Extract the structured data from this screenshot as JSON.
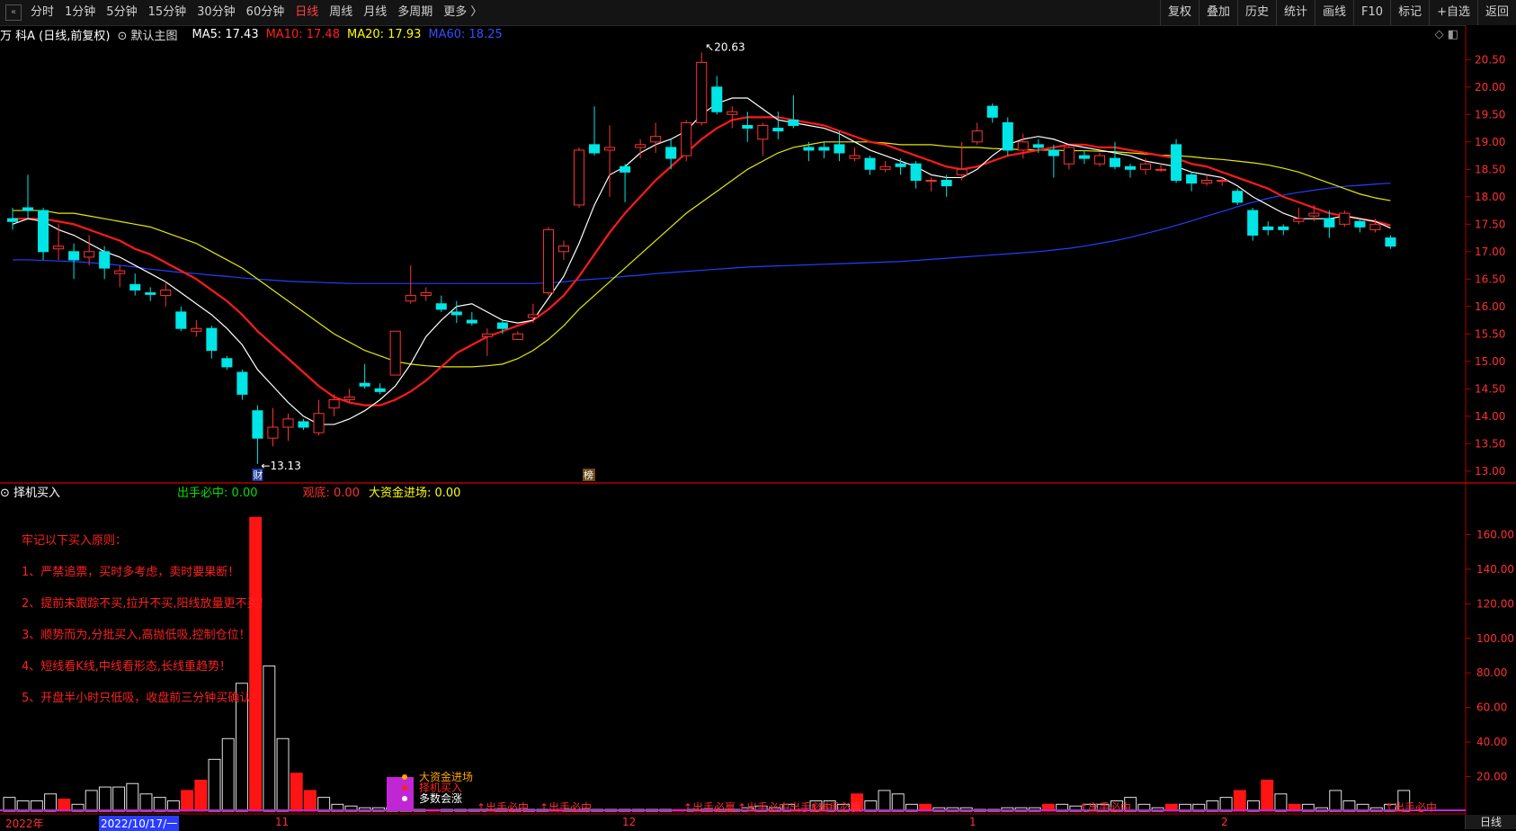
{
  "toolbar": {
    "collapse": "«",
    "periods": [
      "分时",
      "1分钟",
      "5分钟",
      "15分钟",
      "30分钟",
      "60分钟",
      "日线",
      "周线",
      "月线",
      "多周期",
      "更多 〉"
    ],
    "active_period": "日线",
    "right_buttons": [
      "复权",
      "叠加",
      "历史",
      "统计",
      "画线",
      "F10",
      "标记",
      "+自选",
      "返回"
    ]
  },
  "info": {
    "stock": "万 科A (日线,前复权)",
    "main_chart": "默认主图",
    "ma5": "MA5: 17.43",
    "ma10": "MA10: 17.48",
    "ma20": "MA20: 17.93",
    "ma60": "MA60: 18.25",
    "corner": "◇ ◧"
  },
  "panel": {
    "name": "择机买入",
    "f1": "出手必中: 0.00",
    "f2": "观底: 0.00",
    "f3": "大资金进场: 0.00"
  },
  "rules": [
    "牢记以下买入原则：",
    "1、严禁追票，买时多考虑，卖时要果断！",
    "2、提前未跟踪不买,拉升不买,阳线放量更不买！",
    "3、顺势而为,分批买入,高抛低吸,控制仓位！",
    "4、短线看K线,中线看形态,长线重趋势！",
    "5、开盘半小时只低吸，收盘前三分钟买确认！"
  ],
  "markers": {
    "low": "13.13",
    "high": "20.63",
    "cai": "财",
    "bang": "榜"
  },
  "legend": [
    "大资金进场",
    "择机买入",
    "多数会涨"
  ],
  "bottom_signals": [
    "出手必中",
    "出手必中",
    "出手必赢",
    "出手必中出手必中",
    "出手必赢",
    "出手必中",
    "出手必中"
  ],
  "date_axis": [
    "2022年",
    "2022/10/17/一",
    "11",
    "12",
    "1",
    "2"
  ],
  "period_label": "日线",
  "colors": {
    "up": "#ff3232",
    "down": "#00e5e5",
    "ma5": "#ffffff",
    "ma10": "#ff1a1a",
    "ma20": "#e8e800",
    "ma60": "#2040ff"
  },
  "chart_data": {
    "type": "candlestick",
    "ylim": [
      12.8,
      20.8
    ],
    "y_ticks": [
      "20.50",
      "20.00",
      "19.50",
      "19.00",
      "18.50",
      "18.00",
      "17.50",
      "17.00",
      "16.50",
      "16.00",
      "15.50",
      "15.00",
      "14.50",
      "14.00",
      "13.50",
      "13.00"
    ],
    "candles": [
      [
        17.6,
        17.55,
        17.8,
        17.4
      ],
      [
        17.8,
        17.75,
        18.4,
        17.6
      ],
      [
        17.75,
        17.0,
        17.8,
        16.85
      ],
      [
        17.05,
        17.1,
        17.5,
        16.85
      ],
      [
        17.0,
        16.85,
        17.15,
        16.5
      ],
      [
        16.9,
        17.0,
        17.3,
        16.75
      ],
      [
        17.0,
        16.7,
        17.1,
        16.5
      ],
      [
        16.6,
        16.65,
        16.75,
        16.35
      ],
      [
        16.4,
        16.3,
        16.6,
        16.2
      ],
      [
        16.25,
        16.22,
        16.35,
        16.1
      ],
      [
        16.2,
        16.3,
        16.45,
        16.0
      ],
      [
        15.9,
        15.6,
        16.0,
        15.55
      ],
      [
        15.55,
        15.6,
        15.75,
        15.45
      ],
      [
        15.6,
        15.2,
        15.65,
        15.05
      ],
      [
        15.05,
        14.9,
        15.1,
        14.85
      ],
      [
        14.8,
        14.4,
        14.85,
        14.3
      ],
      [
        14.1,
        13.6,
        14.2,
        13.13
      ],
      [
        13.6,
        13.8,
        14.15,
        13.45
      ],
      [
        13.8,
        13.95,
        14.05,
        13.55
      ],
      [
        13.9,
        13.8,
        13.95,
        13.75
      ],
      [
        13.7,
        14.05,
        14.3,
        13.65
      ],
      [
        14.15,
        14.3,
        14.4,
        14.0
      ],
      [
        14.3,
        14.35,
        14.5,
        14.25
      ],
      [
        14.6,
        14.55,
        14.95,
        14.5
      ],
      [
        14.5,
        14.45,
        14.6,
        14.4
      ],
      [
        14.75,
        15.55,
        15.55,
        14.75
      ],
      [
        16.1,
        16.2,
        16.75,
        16.05
      ],
      [
        16.2,
        16.25,
        16.35,
        16.1
      ],
      [
        16.05,
        15.95,
        16.2,
        15.9
      ],
      [
        15.9,
        15.85,
        16.1,
        15.7
      ],
      [
        15.75,
        15.7,
        15.9,
        15.65
      ],
      [
        15.45,
        15.5,
        15.6,
        15.1
      ],
      [
        15.7,
        15.6,
        15.75,
        15.5
      ],
      [
        15.4,
        15.5,
        15.55,
        15.4
      ],
      [
        15.8,
        15.85,
        16.05,
        15.7
      ],
      [
        16.25,
        17.4,
        17.45,
        16.2
      ],
      [
        17.0,
        17.1,
        17.2,
        16.85
      ],
      [
        17.85,
        18.85,
        18.9,
        17.8
      ],
      [
        18.95,
        18.8,
        19.65,
        18.75
      ],
      [
        18.85,
        18.9,
        19.3,
        18.0
      ],
      [
        18.55,
        18.45,
        18.6,
        17.9
      ],
      [
        18.9,
        18.95,
        19.05,
        18.7
      ],
      [
        19.0,
        19.1,
        19.35,
        18.8
      ],
      [
        18.9,
        18.7,
        19.05,
        18.5
      ],
      [
        18.75,
        19.35,
        19.4,
        18.65
      ],
      [
        19.35,
        20.45,
        20.63,
        19.3
      ],
      [
        20.0,
        19.55,
        20.2,
        19.5
      ],
      [
        19.5,
        19.55,
        19.65,
        19.25
      ],
      [
        19.3,
        19.25,
        19.55,
        19.0
      ],
      [
        19.05,
        19.3,
        19.35,
        18.75
      ],
      [
        19.25,
        19.2,
        19.55,
        19.05
      ],
      [
        19.4,
        19.3,
        19.85,
        19.25
      ],
      [
        18.9,
        18.85,
        19.0,
        18.65
      ],
      [
        18.9,
        18.85,
        19.0,
        18.7
      ],
      [
        18.95,
        18.8,
        19.2,
        18.65
      ],
      [
        18.7,
        18.75,
        18.9,
        18.65
      ],
      [
        18.7,
        18.5,
        18.75,
        18.4
      ],
      [
        18.5,
        18.55,
        18.65,
        18.45
      ],
      [
        18.6,
        18.55,
        18.7,
        18.4
      ],
      [
        18.6,
        18.3,
        18.65,
        18.15
      ],
      [
        18.3,
        18.3,
        18.35,
        18.1
      ],
      [
        18.3,
        18.2,
        18.4,
        18.0
      ],
      [
        18.4,
        18.5,
        19.0,
        18.3
      ],
      [
        19.0,
        19.2,
        19.35,
        18.95
      ],
      [
        19.65,
        19.45,
        19.7,
        19.35
      ],
      [
        19.35,
        18.85,
        19.45,
        18.75
      ],
      [
        18.85,
        19.0,
        19.15,
        18.7
      ],
      [
        18.95,
        18.9,
        19.05,
        18.8
      ],
      [
        18.85,
        18.75,
        18.95,
        18.35
      ],
      [
        18.6,
        18.9,
        18.95,
        18.5
      ],
      [
        18.75,
        18.7,
        18.85,
        18.6
      ],
      [
        18.6,
        18.75,
        18.8,
        18.55
      ],
      [
        18.7,
        18.55,
        19.0,
        18.5
      ],
      [
        18.55,
        18.5,
        18.6,
        18.35
      ],
      [
        18.5,
        18.6,
        18.7,
        18.4
      ],
      [
        18.5,
        18.5,
        18.6,
        18.45
      ],
      [
        18.95,
        18.3,
        19.05,
        18.25
      ],
      [
        18.4,
        18.25,
        18.45,
        18.1
      ],
      [
        18.25,
        18.3,
        18.4,
        18.2
      ],
      [
        18.3,
        18.3,
        18.35,
        18.2
      ],
      [
        18.1,
        17.9,
        18.15,
        17.85
      ],
      [
        17.75,
        17.3,
        17.8,
        17.2
      ],
      [
        17.45,
        17.4,
        17.55,
        17.3
      ],
      [
        17.45,
        17.4,
        17.5,
        17.3
      ],
      [
        17.55,
        17.6,
        17.8,
        17.5
      ],
      [
        17.65,
        17.7,
        17.85,
        17.55
      ],
      [
        17.6,
        17.45,
        17.75,
        17.25
      ],
      [
        17.5,
        17.7,
        17.75,
        17.45
      ],
      [
        17.55,
        17.45,
        17.6,
        17.35
      ],
      [
        17.4,
        17.5,
        17.6,
        17.35
      ],
      [
        17.25,
        17.1,
        17.3,
        17.05
      ]
    ],
    "ma5": [
      17.5,
      17.6,
      17.55,
      17.4,
      17.3,
      17.15,
      17.0,
      16.9,
      16.75,
      16.6,
      16.45,
      16.25,
      16.05,
      15.85,
      15.6,
      15.3,
      14.85,
      14.55,
      14.25,
      14.0,
      13.85,
      13.85,
      13.95,
      14.1,
      14.3,
      14.55,
      14.95,
      15.45,
      15.75,
      16.0,
      16.05,
      15.9,
      15.75,
      15.7,
      15.75,
      16.15,
      16.55,
      17.15,
      17.85,
      18.4,
      18.55,
      18.8,
      18.95,
      19.05,
      19.2,
      19.5,
      19.7,
      19.8,
      19.8,
      19.6,
      19.4,
      19.35,
      19.3,
      19.25,
      19.15,
      19.0,
      18.85,
      18.75,
      18.65,
      18.55,
      18.4,
      18.35,
      18.35,
      18.5,
      18.75,
      18.95,
      19.05,
      19.1,
      19.05,
      18.95,
      18.9,
      18.85,
      18.8,
      18.75,
      18.65,
      18.6,
      18.55,
      18.45,
      18.4,
      18.35,
      18.2,
      18.0,
      17.85,
      17.7,
      17.6,
      17.6,
      17.6,
      17.65,
      17.6,
      17.55,
      17.43
    ],
    "ma10": [
      17.6,
      17.6,
      17.6,
      17.55,
      17.5,
      17.4,
      17.3,
      17.2,
      17.05,
      16.95,
      16.8,
      16.65,
      16.5,
      16.3,
      16.1,
      15.85,
      15.55,
      15.3,
      15.05,
      14.8,
      14.55,
      14.35,
      14.25,
      14.2,
      14.2,
      14.3,
      14.45,
      14.65,
      14.9,
      15.15,
      15.3,
      15.45,
      15.55,
      15.65,
      15.75,
      15.95,
      16.2,
      16.55,
      16.95,
      17.35,
      17.7,
      18.0,
      18.3,
      18.55,
      18.8,
      19.05,
      19.25,
      19.4,
      19.45,
      19.45,
      19.45,
      19.4,
      19.35,
      19.3,
      19.2,
      19.1,
      19.0,
      18.95,
      18.85,
      18.75,
      18.65,
      18.55,
      18.5,
      18.55,
      18.65,
      18.75,
      18.8,
      18.85,
      18.9,
      18.95,
      18.95,
      18.9,
      18.9,
      18.85,
      18.8,
      18.75,
      18.7,
      18.6,
      18.55,
      18.45,
      18.35,
      18.25,
      18.15,
      18.0,
      17.9,
      17.8,
      17.7,
      17.65,
      17.6,
      17.55,
      17.48
    ],
    "ma20": [
      17.75,
      17.75,
      17.75,
      17.7,
      17.7,
      17.65,
      17.6,
      17.55,
      17.5,
      17.45,
      17.35,
      17.25,
      17.15,
      17.0,
      16.85,
      16.7,
      16.5,
      16.3,
      16.1,
      15.9,
      15.7,
      15.5,
      15.35,
      15.2,
      15.1,
      15.0,
      14.95,
      14.92,
      14.9,
      14.9,
      14.9,
      14.92,
      14.95,
      15.05,
      15.2,
      15.4,
      15.65,
      15.95,
      16.2,
      16.45,
      16.7,
      16.95,
      17.2,
      17.45,
      17.7,
      17.9,
      18.1,
      18.3,
      18.5,
      18.65,
      18.8,
      18.9,
      18.95,
      19.0,
      19.0,
      19.0,
      19.0,
      18.98,
      18.95,
      18.95,
      18.95,
      18.92,
      18.9,
      18.9,
      18.88,
      18.87,
      18.86,
      18.85,
      18.85,
      18.84,
      18.84,
      18.83,
      18.82,
      18.8,
      18.78,
      18.76,
      18.75,
      18.73,
      18.7,
      18.68,
      18.65,
      18.62,
      18.58,
      18.52,
      18.45,
      18.35,
      18.25,
      18.15,
      18.05,
      17.98,
      17.93
    ],
    "ma60": [
      16.85,
      16.85,
      16.84,
      16.83,
      16.82,
      16.8,
      16.78,
      16.75,
      16.72,
      16.68,
      16.65,
      16.62,
      16.6,
      16.57,
      16.55,
      16.52,
      16.5,
      16.48,
      16.46,
      16.45,
      16.44,
      16.43,
      16.42,
      16.42,
      16.42,
      16.42,
      16.42,
      16.42,
      16.42,
      16.42,
      16.42,
      16.42,
      16.42,
      16.42,
      16.42,
      16.43,
      16.45,
      16.48,
      16.5,
      16.52,
      16.55,
      16.57,
      16.6,
      16.62,
      16.64,
      16.66,
      16.68,
      16.7,
      16.72,
      16.73,
      16.74,
      16.75,
      16.76,
      16.77,
      16.78,
      16.79,
      16.8,
      16.81,
      16.82,
      16.84,
      16.86,
      16.88,
      16.9,
      16.92,
      16.94,
      16.96,
      16.98,
      17.0,
      17.03,
      17.06,
      17.1,
      17.15,
      17.2,
      17.26,
      17.33,
      17.4,
      17.48,
      17.56,
      17.65,
      17.73,
      17.82,
      17.9,
      17.97,
      18.03,
      18.08,
      18.12,
      18.16,
      18.19,
      18.21,
      18.23,
      18.25
    ],
    "volume_ylim": [
      0,
      180
    ],
    "volume_ticks": [
      "160.00",
      "140.00",
      "120.00",
      "100.00",
      "80.00",
      "60.00",
      "40.00",
      "20.00"
    ],
    "volume_panel_bars": [
      8,
      6,
      6,
      10,
      7,
      4,
      12,
      14,
      14,
      16,
      10,
      8,
      6,
      12,
      18,
      30,
      42,
      74,
      170,
      84,
      42,
      22,
      12,
      8,
      4,
      3,
      2,
      2,
      2,
      1,
      1,
      1,
      1,
      1,
      1,
      1,
      1,
      1,
      1,
      1,
      1,
      1,
      1,
      1,
      1,
      1,
      1,
      1,
      1,
      1,
      1,
      1,
      1,
      1,
      2,
      3,
      2,
      4,
      1,
      6,
      6,
      4,
      10,
      6,
      12,
      10,
      4,
      4,
      2,
      2,
      2,
      1,
      1,
      2,
      2,
      2,
      4,
      4,
      3,
      4,
      4,
      6,
      8,
      4,
      2,
      4,
      4,
      4,
      6,
      8,
      12,
      6,
      18,
      10,
      4,
      4,
      2,
      12,
      6,
      4,
      2,
      4,
      12
    ]
  }
}
